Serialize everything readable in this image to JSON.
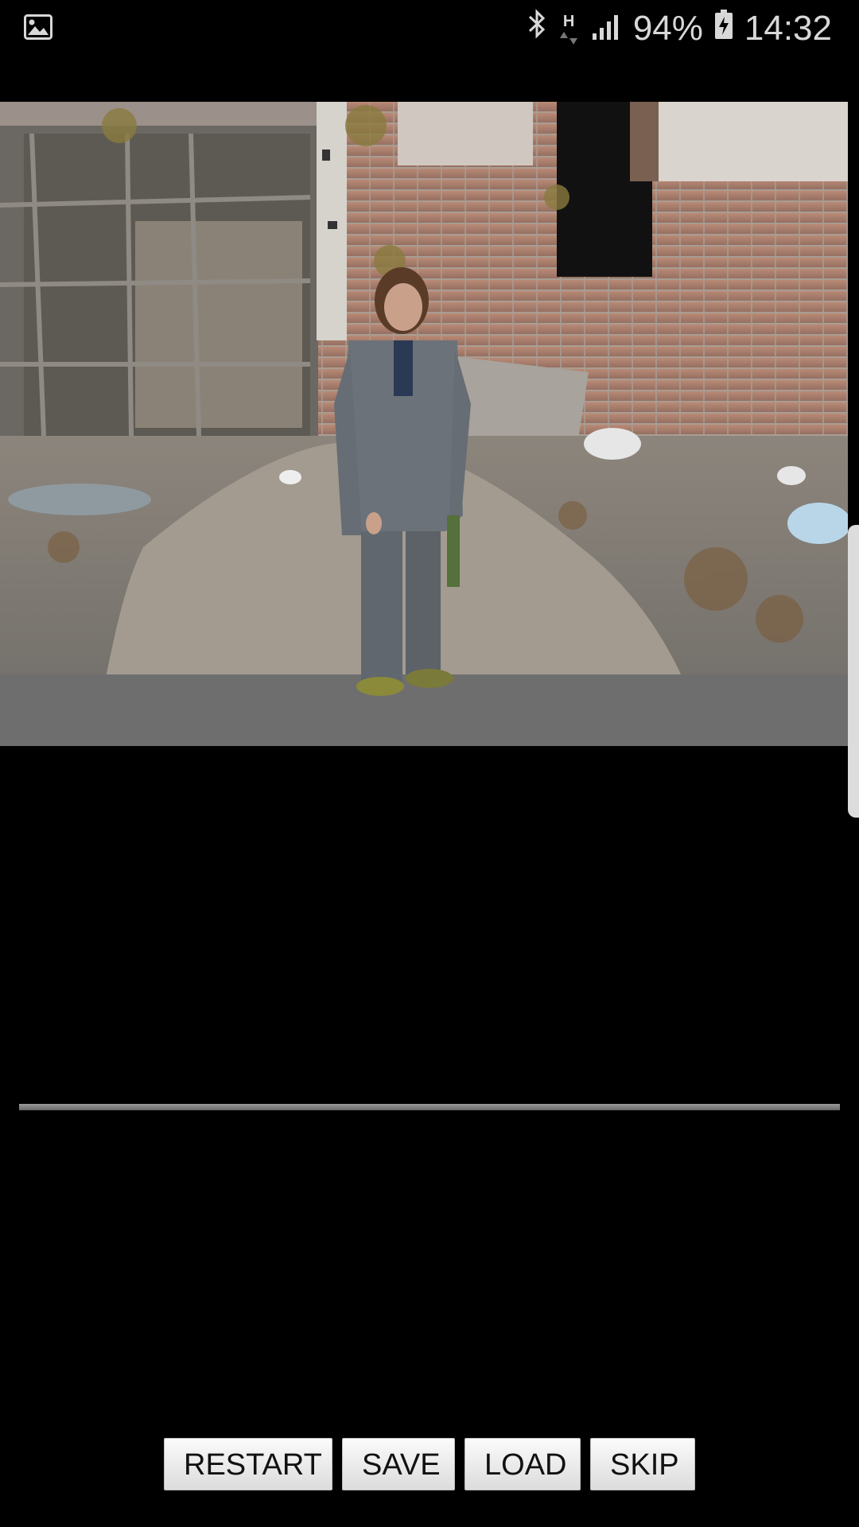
{
  "status_bar": {
    "left_icon": "image-notification-icon",
    "bluetooth_icon": "bluetooth-icon",
    "network_type": "H",
    "signal_icon": "signal-strength-icon",
    "battery_percent": "94%",
    "battery_icon": "battery-charging-icon",
    "time": "14:32"
  },
  "scene": {
    "description_icon": "photo-scene"
  },
  "buttons": {
    "restart_label": "RESTART",
    "save_label": "SAVE",
    "load_label": "LOAD",
    "skip_label": "SKIP"
  },
  "colors": {
    "background": "#000000",
    "button_bg": "#ececec",
    "status_text": "#d8d8d8"
  }
}
